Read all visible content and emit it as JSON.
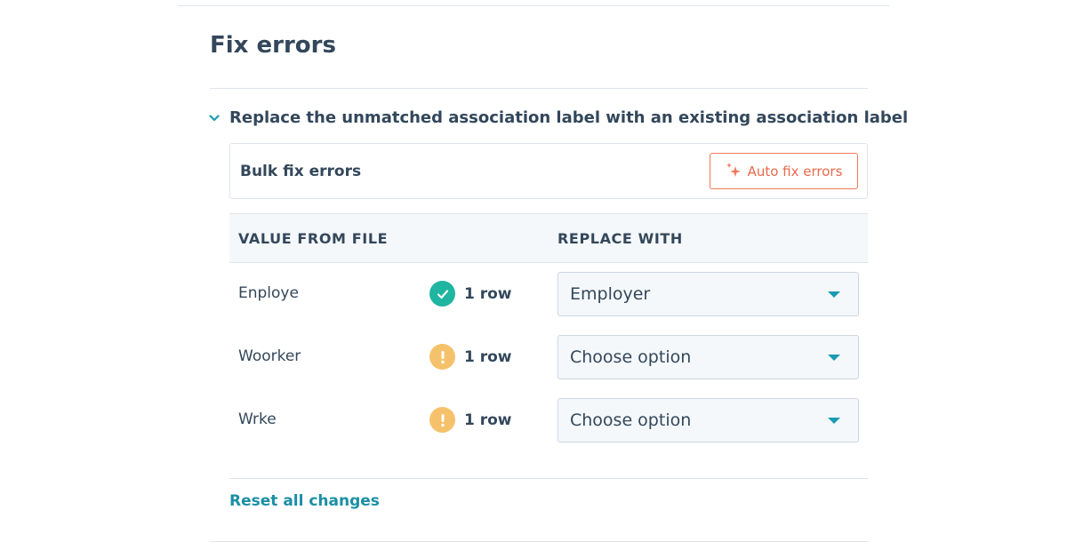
{
  "page": {
    "title": "Fix errors"
  },
  "section": {
    "title": "Replace the unmatched association label with an existing association label",
    "expanded": true
  },
  "bulk": {
    "label": "Bulk fix errors",
    "auto_fix_label": "Auto fix errors"
  },
  "table": {
    "headers": [
      "VALUE FROM FILE",
      "REPLACE WITH"
    ],
    "rows": [
      {
        "value": "Enploye",
        "status": "resolved",
        "status_icon": "check-icon",
        "count": "1 row",
        "replace_with": "Employer"
      },
      {
        "value": "Woorker",
        "status": "warning",
        "status_icon": "exclamation-icon",
        "count": "1 row",
        "replace_with": "Choose option"
      },
      {
        "value": "Wrke",
        "status": "warning",
        "status_icon": "exclamation-icon",
        "count": "1 row",
        "replace_with": "Choose option"
      }
    ]
  },
  "footer": {
    "reset_label": "Reset all changes"
  },
  "colors": {
    "accent_teal": "#1a8fa5",
    "success": "#1fb5a0",
    "warning": "#f5c26b",
    "auto_fix": "#f0775a",
    "text": "#33475b"
  }
}
